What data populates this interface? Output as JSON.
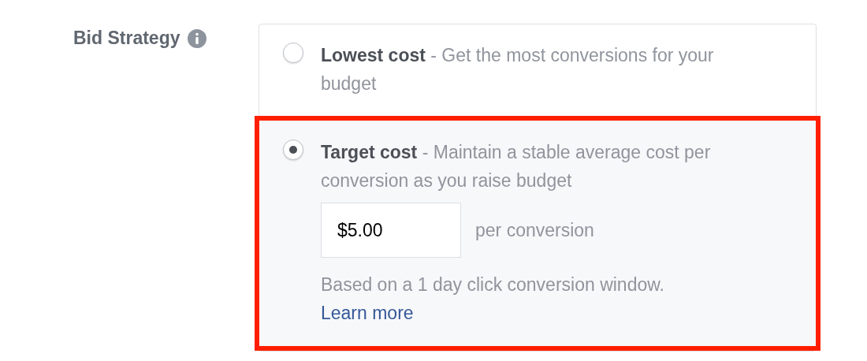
{
  "field": {
    "label": "Bid Strategy"
  },
  "options": [
    {
      "text": "**Lowest cost** - Get the most conversions for your budget",
      "selected": false,
      "highlighted": false
    },
    {
      "text": "**Target cost** - Maintain a stable average cost per conversion as you raise budget",
      "selected": true,
      "highlighted": true,
      "input": {
        "value": "$5.00"
      },
      "suffix": "per conversion",
      "note": "Based on a 1 day click conversion window.",
      "link": "Learn more"
    }
  ]
}
